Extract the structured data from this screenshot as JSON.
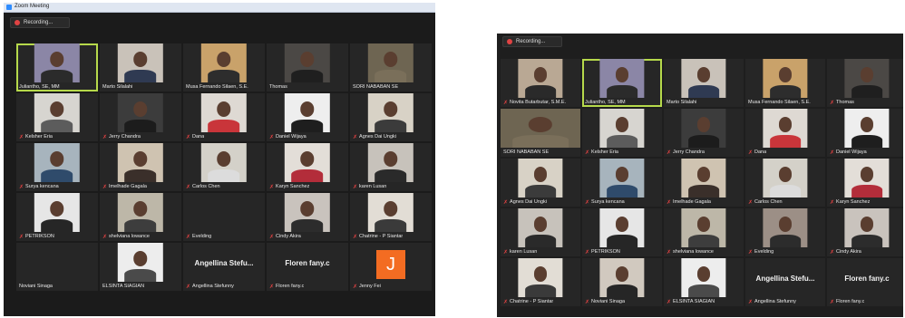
{
  "screens": [
    {
      "window_title": "Zoom Meeting",
      "recording_label": "Recording...",
      "tiles": [
        {
          "name": "Juliantho, SE, MM",
          "muted": false,
          "active": true,
          "bg": "#8b86a6",
          "shirt": "#2b2b2b"
        },
        {
          "name": "Marto Silalahi",
          "muted": false,
          "bg": "#c9c2b9",
          "shirt": "#2f3a52"
        },
        {
          "name": "Musa Fernando Silaen, S.E.",
          "muted": false,
          "bg": "#c9a26a",
          "shirt": "#2d2d2d"
        },
        {
          "name": "Thomas",
          "muted": false,
          "bg": "#4b4845",
          "shirt": "#1f1f1f"
        },
        {
          "name": "SORI NABABAN SE",
          "muted": false,
          "bg": "#6e6552",
          "shirt": "#7a6f5a"
        },
        {
          "name": "Kelsher Eria",
          "muted": true,
          "bg": "#d7d5d0",
          "shirt": "#5c5c5c"
        },
        {
          "name": "Jerry Chandra",
          "muted": true,
          "bg": "#3c3c3c",
          "shirt": "#1c1c1c"
        },
        {
          "name": "Dana",
          "muted": true,
          "bg": "#ded9d3",
          "shirt": "#c9353a"
        },
        {
          "name": "Daniel Wijaya",
          "muted": true,
          "bg": "#eeeeee",
          "shirt": "#1e1e1e"
        },
        {
          "name": "Agnes Dai Ungki",
          "muted": true,
          "bg": "#d8d2c6",
          "shirt": "#3b3b3b"
        },
        {
          "name": "Surya kencana",
          "muted": true,
          "bg": "#a7b4bd",
          "shirt": "#2f4b6b"
        },
        {
          "name": "Imelhade Gagala",
          "muted": true,
          "bg": "#cfc3b1",
          "shirt": "#3a2f2a"
        },
        {
          "name": "Carlos Chen",
          "muted": true,
          "bg": "#d4d1c9",
          "shirt": "#dcdcdc"
        },
        {
          "name": "Karyn Sanchez",
          "muted": true,
          "bg": "#e3ded8",
          "shirt": "#b32d3a"
        },
        {
          "name": "karen Lusan",
          "muted": true,
          "bg": "#c7c2bb",
          "shirt": "#2a2a2a"
        },
        {
          "name": "PETRIKSON",
          "muted": true,
          "bg": "#e6e6e6",
          "shirt": "#262626"
        },
        {
          "name": "shelviana lowance",
          "muted": true,
          "bg": "#bdb7a8",
          "shirt": "#3d3d3d"
        },
        {
          "name": "Evelding",
          "muted": true,
          "bg": "#262626",
          "shirt": "#262626",
          "blank": true
        },
        {
          "name": "Cindy Akira",
          "muted": true,
          "bg": "#c9c3bd",
          "shirt": "#2c2c2c"
        },
        {
          "name": "Chatrine - P Siantar",
          "muted": true,
          "bg": "#e2ddd5",
          "shirt": "#3a3a3a"
        },
        {
          "name": "Noviani Sinaga",
          "muted": false,
          "bg": "#262626",
          "shirt": "#262626",
          "blank": true
        },
        {
          "name": "ELSINTA SIAGIAN",
          "muted": false,
          "bg": "#ededed",
          "shirt": "#4a4a4a"
        },
        {
          "name": "Angellina Stefunny",
          "muted": true,
          "card": "Angellina Stefu..."
        },
        {
          "name": "Floren fany.c",
          "muted": true,
          "card": "Floren fany.c"
        },
        {
          "name": "Jenny Fei",
          "muted": true,
          "avatar": "J"
        }
      ]
    },
    {
      "recording_label": "Recording...",
      "tiles": [
        {
          "name": "Novita Butarbutar, S.M.E.",
          "muted": true,
          "bg": "#b9a894",
          "shirt": "#2a2a2a"
        },
        {
          "name": "Juliantho, SE, MM",
          "muted": false,
          "active": true,
          "bg": "#8b86a6",
          "shirt": "#2b2b2b"
        },
        {
          "name": "Marto Silalahi",
          "muted": false,
          "bg": "#c9c2b9",
          "shirt": "#2f3a52"
        },
        {
          "name": "Musa Fernando Silaen, S.E.",
          "muted": false,
          "bg": "#c9a26a",
          "shirt": "#2d2d2d"
        },
        {
          "name": "Thomas",
          "muted": true,
          "bg": "#4b4845",
          "shirt": "#1f1f1f"
        },
        {
          "name": "SORI NABABAN SE",
          "muted": false,
          "bg": "#6e6552",
          "shirt": "#7a6f5a"
        },
        {
          "name": "Kelsher Eria",
          "muted": true,
          "bg": "#d7d5d0",
          "shirt": "#5c5c5c"
        },
        {
          "name": "Jerry Chandra",
          "muted": true,
          "bg": "#3c3c3c",
          "shirt": "#1c1c1c"
        },
        {
          "name": "Dana",
          "muted": true,
          "bg": "#ded9d3",
          "shirt": "#c9353a"
        },
        {
          "name": "Daniel Wijaya",
          "muted": true,
          "bg": "#eeeeee",
          "shirt": "#1e1e1e"
        },
        {
          "name": "Agnes Dai Ungki",
          "muted": true,
          "bg": "#d8d2c6",
          "shirt": "#3b3b3b"
        },
        {
          "name": "Surya kencana",
          "muted": true,
          "bg": "#a7b4bd",
          "shirt": "#2f4b6b"
        },
        {
          "name": "Imelhade Gagala",
          "muted": true,
          "bg": "#cfc3b1",
          "shirt": "#3a2f2a"
        },
        {
          "name": "Carlos Chen",
          "muted": true,
          "bg": "#d4d1c9",
          "shirt": "#dcdcdc"
        },
        {
          "name": "Karyn Sanchez",
          "muted": true,
          "bg": "#e3ded8",
          "shirt": "#b32d3a"
        },
        {
          "name": "karen Lusan",
          "muted": true,
          "bg": "#c7c2bb",
          "shirt": "#2a2a2a"
        },
        {
          "name": "PETRIKSON",
          "muted": true,
          "bg": "#e6e6e6",
          "shirt": "#262626"
        },
        {
          "name": "shelviana lowance",
          "muted": true,
          "bg": "#bdb7a8",
          "shirt": "#3d3d3d"
        },
        {
          "name": "Evelding",
          "muted": true,
          "bg": "#9c8f86",
          "shirt": "#2c2c2c"
        },
        {
          "name": "Cindy Akira",
          "muted": true,
          "bg": "#c9c3bd",
          "shirt": "#2c2c2c"
        },
        {
          "name": "Chatrine - P Siantar",
          "muted": true,
          "bg": "#e2ddd5",
          "shirt": "#3a3a3a"
        },
        {
          "name": "Noviani Sinaga",
          "muted": true,
          "bg": "#d1c9bf",
          "shirt": "#262626"
        },
        {
          "name": "ELSINTA SIAGIAN",
          "muted": true,
          "bg": "#ededed",
          "shirt": "#4a4a4a"
        },
        {
          "name": "Angellina Stefunny",
          "muted": true,
          "card": "Angellina Stefu..."
        },
        {
          "name": "Floren fany.c",
          "muted": true,
          "card": "Floren fany.c"
        }
      ]
    }
  ]
}
